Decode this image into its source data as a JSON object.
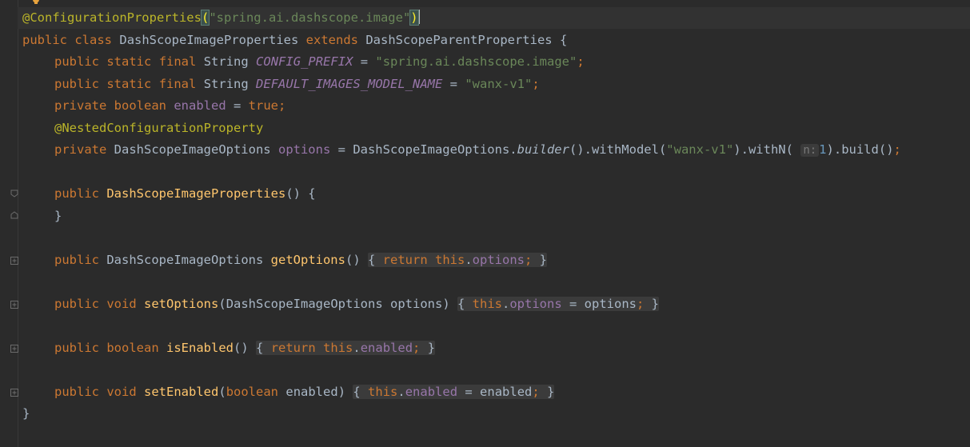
{
  "editor": {
    "language": "java",
    "lines": {
      "annotation_name": "@ConfigurationProperties",
      "prefix_string": "\"spring.ai.dashscope.image\"",
      "kw_public": "public",
      "kw_class": "class",
      "kw_static": "static",
      "kw_final": "final",
      "kw_private": "private",
      "kw_boolean": "boolean",
      "kw_void": "void",
      "kw_extends": "extends",
      "kw_return": "return",
      "kw_this": "this",
      "kw_true": "true",
      "class_name": "DashScopeImageProperties",
      "parent_class": "DashScopeParentProperties",
      "type_string": "String",
      "config_prefix_name": "CONFIG_PREFIX",
      "default_model_name": "DEFAULT_IMAGES_MODEL_NAME",
      "model_string": "\"wanx-v1\"",
      "field_enabled": "enabled",
      "nested_annotation": "@NestedConfigurationProperty",
      "options_type": "DashScopeImageOptions",
      "field_options": "options",
      "builder_method": "builder",
      "with_model_method": "withModel",
      "with_n_method": "withN",
      "param_hint_n": "n:",
      "n_value": "1",
      "build_method": "build",
      "get_options": "getOptions",
      "set_options": "setOptions",
      "is_enabled": "isEnabled",
      "set_enabled": "setEnabled",
      "param_options": "options",
      "param_enabled": "enabled"
    }
  },
  "colors": {
    "background": "#2b2b2b",
    "keyword": "#cc7832",
    "annotation": "#bbb529",
    "string": "#6a8759",
    "field": "#9876aa",
    "method": "#ffc66d",
    "number": "#6897bb",
    "text": "#a9b7c6"
  }
}
